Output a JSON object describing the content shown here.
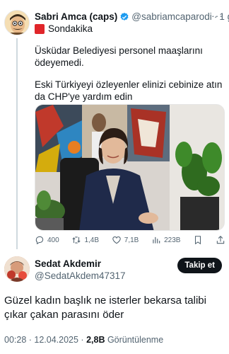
{
  "quoted_tweet": {
    "author_name": "Sabri Amca (caps)",
    "handle": "@sabriamcaparodi",
    "separator": "·",
    "time": "1 g",
    "more_label": "···",
    "tag_text": "Sondakika",
    "text_line1": "Üsküdar Belediyesi personel maaşlarını ödeyemedi.",
    "text_line2": "Eski Türkiyeyi özleyenler elinizi cebinize atın da CHP'ye yardım edin",
    "actions": {
      "replies": "400",
      "retweets": "1,4B",
      "likes": "7,1B",
      "views": "223B"
    }
  },
  "main_tweet": {
    "author_name": "Sedat Akdemir",
    "handle": "@SedatAkdem47317",
    "follow_label": "Takip et",
    "text": "Güzel kadın başlık ne isterler bekarsa talibi çıkar çakan parasını öder",
    "time": "00:28 · 12.04.2025 · ",
    "views_count": "2,8B",
    "views_label": " Görüntülenme"
  },
  "colors": {
    "verified_blue": "#1d9bf0",
    "text_primary": "#0f1419",
    "text_secondary": "#536471",
    "flag_red": "#e0262a"
  }
}
